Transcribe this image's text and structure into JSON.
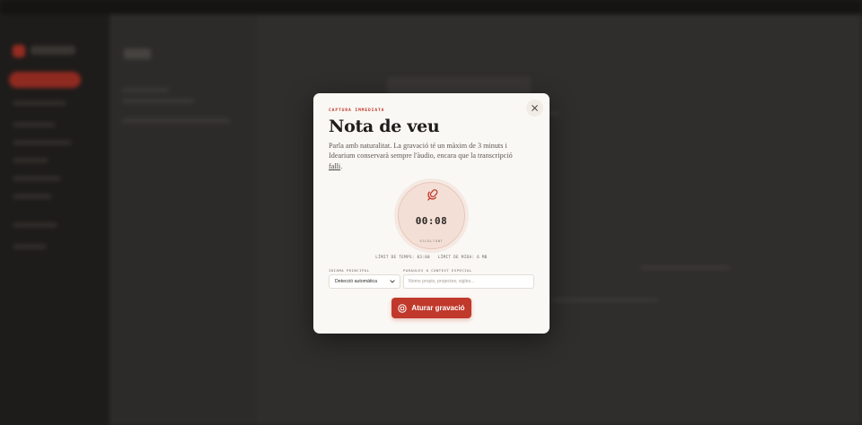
{
  "modal": {
    "eyebrow": "CAPTURA IMMEDIATA",
    "title": "Nota de veu",
    "description": "Parla amb naturalitat. La gravació té un màxim de 3 minuts i Idearium conservarà sempre l'àudio, encara que la transcripció ",
    "description_link": "falli",
    "description_end": ".",
    "recorder": {
      "timer": "00:08",
      "status": "ESCOLTANT"
    },
    "limits": {
      "time": "LÍMIT DE TEMPS: 03:00",
      "size": "LÍMIT DE MIDA: 6 MB"
    },
    "language": {
      "label": "IDIOMA PRINCIPAL",
      "value": "Detecció automàtica"
    },
    "context": {
      "label": "PARAULES O CONTEXT ESPECIAL",
      "placeholder": "Noms propis, projectes, sigles..."
    },
    "stop_button": "Aturar gravació",
    "icons": {
      "close": "close-icon",
      "mic": "microphone-icon",
      "stop": "stop-icon",
      "chevron": "chevron-down-icon"
    },
    "colors": {
      "accent": "#c0392b",
      "modal_bg": "#faf8f4",
      "recorder_bg": "#f4dfd6"
    }
  }
}
